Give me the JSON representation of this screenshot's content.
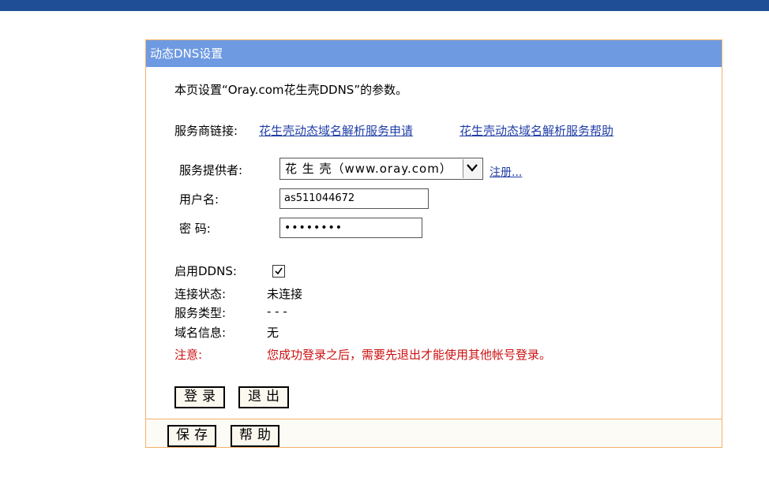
{
  "panel": {
    "title": "动态DNS设置",
    "description": "本页设置“Oray.com花生壳DDNS”的参数。",
    "provider_links": {
      "label": "服务商链接:",
      "apply_link": "花生壳动态域名解析服务申请",
      "help_link": "花生壳动态域名解析服务帮助"
    },
    "form": {
      "provider_label": "服务提供者:",
      "provider_value": "花 生 壳（www.oray.com）",
      "register_link": "注册...",
      "username_label": "用户名:",
      "username_value": "as511044672",
      "password_label": "密 码:",
      "password_value": "••••••••"
    },
    "status": {
      "enable_label": "启用DDNS:",
      "enabled": true,
      "connection_label": "连接状态:",
      "connection_value": "未连接",
      "service_type_label": "服务类型:",
      "service_type_value": "- - -",
      "domain_label": "域名信息:",
      "domain_value": "无",
      "note_label": "注意:",
      "note_value": "您成功登录之后，需要先退出才能使用其他帐号登录。"
    },
    "buttons": {
      "login": "登录",
      "logout": "退出"
    },
    "footer": {
      "save": "保存",
      "help": "帮助"
    }
  },
  "colors": {
    "top_bar": "#1f4e96",
    "header": "#6e9ae2",
    "border": "#f2b26a",
    "link": "#1f3da6",
    "warning": "#cc1111"
  }
}
